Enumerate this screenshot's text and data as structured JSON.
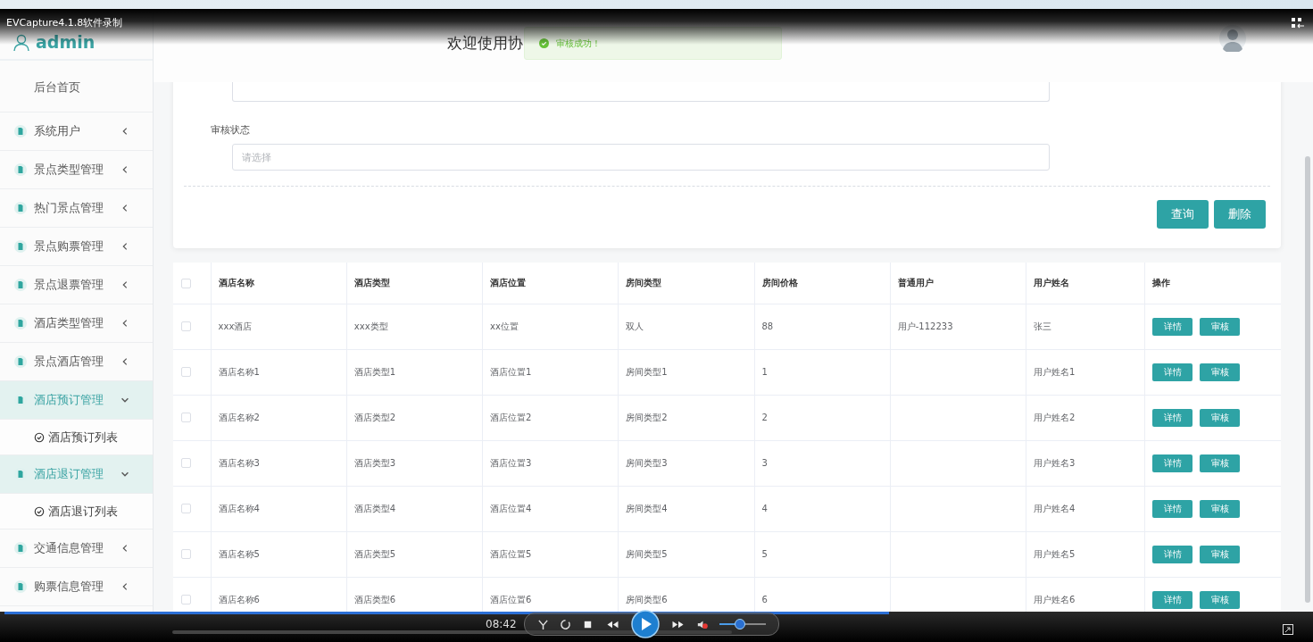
{
  "recorder": {
    "title": "EVCapture4.1.8软件录制",
    "time": "08:42",
    "progress": {
      "level": 0.68
    },
    "volume": {
      "level": 0.45,
      "muted": true
    }
  },
  "sidebar": {
    "user": "admin",
    "items": [
      {
        "label": "后台首页",
        "kind": "home"
      },
      {
        "label": "系统用户",
        "kind": "menu",
        "expanded": false
      },
      {
        "label": "景点类型管理",
        "kind": "menu",
        "expanded": false
      },
      {
        "label": "热门景点管理",
        "kind": "menu",
        "expanded": false
      },
      {
        "label": "景点购票管理",
        "kind": "menu",
        "expanded": false
      },
      {
        "label": "景点退票管理",
        "kind": "menu",
        "expanded": false
      },
      {
        "label": "酒店类型管理",
        "kind": "menu",
        "expanded": false
      },
      {
        "label": "景点酒店管理",
        "kind": "menu",
        "expanded": false
      },
      {
        "label": "酒店预订管理",
        "kind": "menu",
        "expanded": true,
        "children": [
          {
            "label": "酒店预订列表"
          }
        ]
      },
      {
        "label": "酒店退订管理",
        "kind": "menu",
        "expanded": true,
        "children": [
          {
            "label": "酒店退订列表"
          }
        ]
      },
      {
        "label": "交通信息管理",
        "kind": "menu",
        "expanded": false
      },
      {
        "label": "购票信息管理",
        "kind": "menu",
        "expanded": false
      }
    ]
  },
  "header": {
    "title": "欢迎使用协"
  },
  "toast": {
    "message": "审核成功！"
  },
  "search": {
    "fields": [
      {
        "label": "审核状态",
        "placeholder": "请选择"
      }
    ],
    "buttons": [
      "查询",
      "删除"
    ]
  },
  "table": {
    "columns": [
      "酒店名称",
      "酒店类型",
      "酒店位置",
      "房间类型",
      "房间价格",
      "普通用户",
      "用户姓名",
      "操作"
    ],
    "header_checked": false,
    "rows": [
      {
        "checked": false,
        "cells": [
          "xxx酒店",
          "xxx类型",
          "xx位置",
          "双人",
          "88",
          "用户-112233",
          "张三"
        ],
        "actions": [
          "详情",
          "审核"
        ]
      },
      {
        "checked": false,
        "cells": [
          "酒店名称1",
          "酒店类型1",
          "酒店位置1",
          "房间类型1",
          "1",
          "",
          "用户姓名1"
        ],
        "actions": [
          "详情",
          "审核"
        ]
      },
      {
        "checked": false,
        "cells": [
          "酒店名称2",
          "酒店类型2",
          "酒店位置2",
          "房间类型2",
          "2",
          "",
          "用户姓名2"
        ],
        "actions": [
          "详情",
          "审核"
        ]
      },
      {
        "checked": false,
        "cells": [
          "酒店名称3",
          "酒店类型3",
          "酒店位置3",
          "房间类型3",
          "3",
          "",
          "用户姓名3"
        ],
        "actions": [
          "详情",
          "审核"
        ]
      },
      {
        "checked": false,
        "cells": [
          "酒店名称4",
          "酒店类型4",
          "酒店位置4",
          "房间类型4",
          "4",
          "",
          "用户姓名4"
        ],
        "actions": [
          "详情",
          "审核"
        ]
      },
      {
        "checked": false,
        "cells": [
          "酒店名称5",
          "酒店类型5",
          "酒店位置5",
          "房间类型5",
          "5",
          "",
          "用户姓名5"
        ],
        "actions": [
          "详情",
          "审核"
        ]
      },
      {
        "checked": false,
        "cells": [
          "酒店名称6",
          "酒店类型6",
          "酒店位置6",
          "房间类型6",
          "6",
          "",
          "用户姓名6"
        ],
        "actions": [
          "详情",
          "审核"
        ]
      }
    ]
  }
}
